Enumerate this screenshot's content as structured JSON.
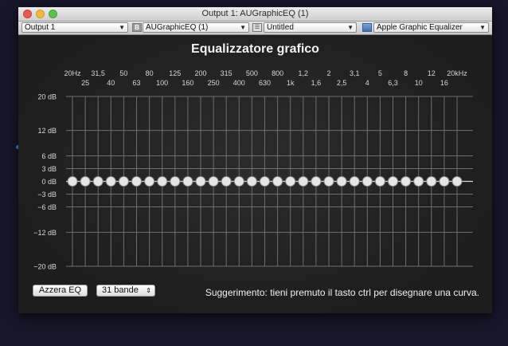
{
  "window": {
    "title": "Output 1: AUGraphicEQ (1)"
  },
  "toolbar": {
    "output_select": "Output 1",
    "plugin_badge": "B",
    "plugin_select": "AUGraphicEQ (1)",
    "preset_select": "Untitled",
    "view_select": "Apple Graphic Equalizer"
  },
  "eq": {
    "title": "Equalizzatore grafico",
    "freq_top": [
      "20Hz",
      "31,5",
      "50",
      "80",
      "125",
      "200",
      "315",
      "500",
      "800",
      "1,2",
      "2",
      "3,1",
      "5",
      "8",
      "12",
      "20kHz"
    ],
    "freq_bottom": [
      "25",
      "40",
      "63",
      "100",
      "160",
      "250",
      "400",
      "630",
      "1k",
      "1,6",
      "2,5",
      "4",
      "6,3",
      "10",
      "16"
    ],
    "db_labels": [
      "20 dB",
      "12 dB",
      "6 dB",
      "3 dB",
      "0 dB",
      "−3 dB",
      "−6 dB",
      "−12 dB",
      "−20 dB"
    ],
    "band_gains_db": [
      0,
      0,
      0,
      0,
      0,
      0,
      0,
      0,
      0,
      0,
      0,
      0,
      0,
      0,
      0,
      0,
      0,
      0,
      0,
      0,
      0,
      0,
      0,
      0,
      0,
      0,
      0,
      0,
      0,
      0,
      0
    ]
  },
  "controls": {
    "reset_label": "Azzera EQ",
    "bands_select": "31 bande",
    "hint": "Suggerimento: tieni premuto il tasto ctrl per disegnare una curva."
  },
  "colors": {
    "grid": "#6e6e6e",
    "zero_line": "#d8d8d8",
    "knob": "#e6e6e6"
  }
}
